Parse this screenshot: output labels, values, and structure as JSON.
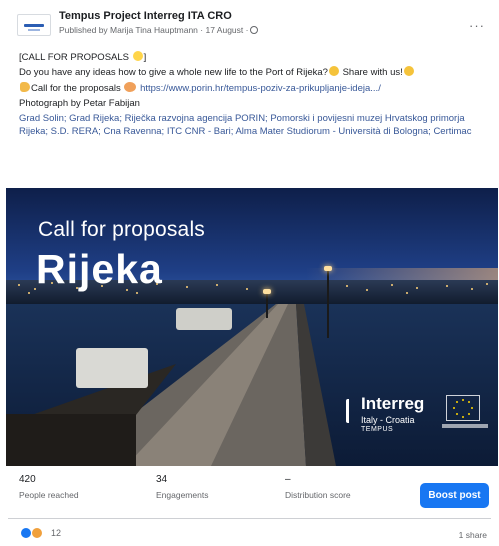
{
  "post": {
    "page_name": "Tempus Project Interreg ITA CRO",
    "meta": "Published by Marija Tina Hauptmann · 17 August ·",
    "icons": {
      "author": "person-icon",
      "audience": "globe-icon",
      "more": "more-options-icon"
    },
    "lines": {
      "l1": "[CALL FOR PROPOSALS",
      "l1_end": "]",
      "l2": "Do you have any ideas how to give a whole new life to the Port of Rijeka?",
      "l2_end": "Share with us!",
      "l3_pre": "Call for the proposals",
      "l3_link": "https://www.porin.hr/tempus-poziv-za-prikupljanje-ideja.../",
      "l4": "Photograph by Petar Fabijan",
      "tags": "Grad Solin; Grad Rijeka; Riječka razvojna agencija PORIN; Pomorski i povijesni muzej Hrvatskog primorja Rijeka; S.D. RERA; Cna Ravenna; ITC CNR - Bari; Alma Mater Studiorum - Università di Bologna; Certimac"
    }
  },
  "image": {
    "caption_line1": "Call for proposals",
    "caption_line2": "Rijeka",
    "brand_title": "Interreg",
    "brand_sub": "Italy - Croatia",
    "brand_sub2": "TEMPUS"
  },
  "stats": {
    "reached": {
      "value": "420",
      "label": "People reached"
    },
    "engagements": {
      "value": "34",
      "label": "Engagements"
    },
    "distribution": {
      "value": "–",
      "label": "Distribution score"
    },
    "boost_label": "Boost post"
  },
  "footer": {
    "reaction_count": "12",
    "shares": "1 share"
  },
  "colors": {
    "link": "#385898",
    "boost": "#1877f2",
    "secondary_text": "#65676b"
  }
}
